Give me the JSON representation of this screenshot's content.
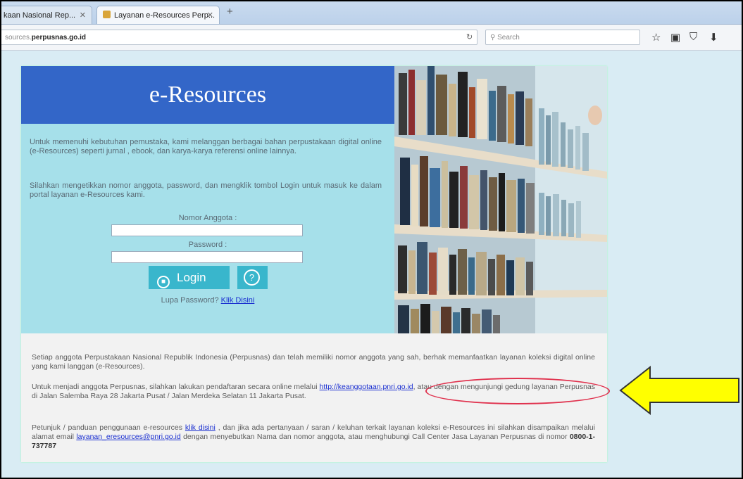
{
  "browser": {
    "tabs": [
      {
        "label": "kaan Nasional Rep..."
      },
      {
        "label": "Layanan e-Resources Perp..."
      }
    ],
    "url_prefix": "sources.",
    "url_domain": "perpusnas.go.id",
    "search_placeholder": "Search"
  },
  "panel": {
    "title": "e-Resources",
    "intro": "Untuk memenuhi kebutuhan pemustaka, kami melanggan berbagai bahan perpustakaan digital online (e-Resources) seperti jurnal , ebook, dan karya-karya referensi online lainnya.",
    "instruction": "Silahkan mengetikkan nomor anggota, password, dan mengklik tombol Login untuk masuk ke dalam portal layanan e-Resources kami.",
    "member_label": "Nomor Anggota :",
    "password_label": "Password :",
    "login_label": "Login",
    "forgot_text": "Lupa Password?",
    "forgot_link": "Klik Disini"
  },
  "info": {
    "p1": "Setiap anggota Perpustakaan Nasional Republik Indonesia (Perpusnas) dan telah memiliki nomor anggota yang sah, berhak memanfaatkan layanan koleksi digital online yang kami langgan (e-Resources).",
    "p2_before": "Untuk menjadi anggota Perpusnas, silahkan lakukan pendaftaran secara online melalui",
    "p2_link": "http://keanggotaan.pnri.go.id",
    "p2_after": ", atau dengan mengunjungi gedung layanan Perpusnas di Jalan Salemba Raya 28 Jakarta Pusat / Jalan Merdeka Selatan 11 Jakarta Pusat.",
    "p3_a": "Petunjuk / panduan penggunaan e-resources",
    "p3_link1": "klik disini",
    "p3_b": ", dan jika ada pertanyaan / saran / keluhan terkait layanan koleksi e-Resources ini silahkan disampaikan melalui alamat email",
    "p3_link2": "layanan_eresources@pnri.go.id",
    "p3_c": "dengan menyebutkan Nama dan nomor anggota, atau menghubungi Call Center Jasa Layanan Perpusnas di nomor",
    "p3_phone": "0800-1-737787"
  },
  "colors": {
    "title_bg": "#3366c8",
    "panel_bg": "#a6e0ea",
    "button_bg": "#39b6cc",
    "highlight": "#e0324e",
    "arrow_fill": "#ffff00"
  }
}
